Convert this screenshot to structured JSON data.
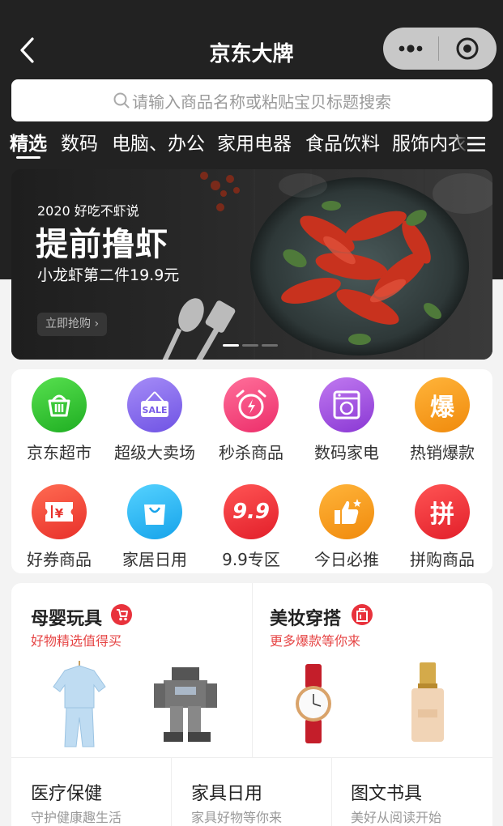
{
  "header": {
    "title": "京东大牌",
    "back_icon": "back-icon",
    "more_icon": "more-dots-icon",
    "close_icon": "target-icon"
  },
  "search": {
    "placeholder": "请输入商品名称或粘贴宝贝标题搜索"
  },
  "tabs": [
    {
      "label": "精选",
      "active": true
    },
    {
      "label": "数码",
      "active": false
    },
    {
      "label": "电脑、办公",
      "active": false
    },
    {
      "label": "家用电器",
      "active": false
    },
    {
      "label": "食品饮料",
      "active": false
    },
    {
      "label": "服饰内衣",
      "active": false
    }
  ],
  "banner": {
    "subtitle": "2020 好吃不虾说",
    "title": "提前撸虾",
    "desc": "小龙虾第二件19.9元",
    "button": "立即抢购 ›",
    "slides": 3,
    "active_slide": 0
  },
  "categories": [
    {
      "label": "京东超市",
      "icon": "basket-icon",
      "color": "#2ec12e"
    },
    {
      "label": "超级大卖场",
      "icon": "sale-sign-icon",
      "color": "#8a6cf0"
    },
    {
      "label": "秒杀商品",
      "icon": "alarm-clock-icon",
      "color": "#f0467e"
    },
    {
      "label": "数码家电",
      "icon": "washing-machine-icon",
      "color": "#a451e0"
    },
    {
      "label": "热销爆款",
      "icon": "hot-sale-icon",
      "color": "#f39a1a",
      "glyph": "爆"
    },
    {
      "label": "好券商品",
      "icon": "coupon-icon",
      "color": "#f04a3a"
    },
    {
      "label": "家居日用",
      "icon": "shopping-bag-icon",
      "color": "#25b6f0"
    },
    {
      "label": "9.9专区",
      "icon": "price-99-icon",
      "color": "#f03a3a",
      "glyph": "9.9"
    },
    {
      "label": "今日必推",
      "icon": "thumbs-up-icon",
      "color": "#f39a1a"
    },
    {
      "label": "拼购商品",
      "icon": "group-buy-icon",
      "color": "#f03a3a",
      "glyph": "拼"
    }
  ],
  "sections": {
    "baby": {
      "title": "母婴玩具",
      "subtitle": "好物精选值得买",
      "badge_icon": "stroller-icon"
    },
    "beauty": {
      "title": "美妆穿搭",
      "subtitle": "更多爆款等你来",
      "badge_icon": "dress-icon"
    },
    "health": {
      "title": "医疗保健",
      "subtitle": "守护健康趣生活"
    },
    "furniture": {
      "title": "家具日用",
      "subtitle": "家具好物等你来"
    },
    "books": {
      "title": "图文书具",
      "subtitle": "美好从阅读开始"
    }
  }
}
